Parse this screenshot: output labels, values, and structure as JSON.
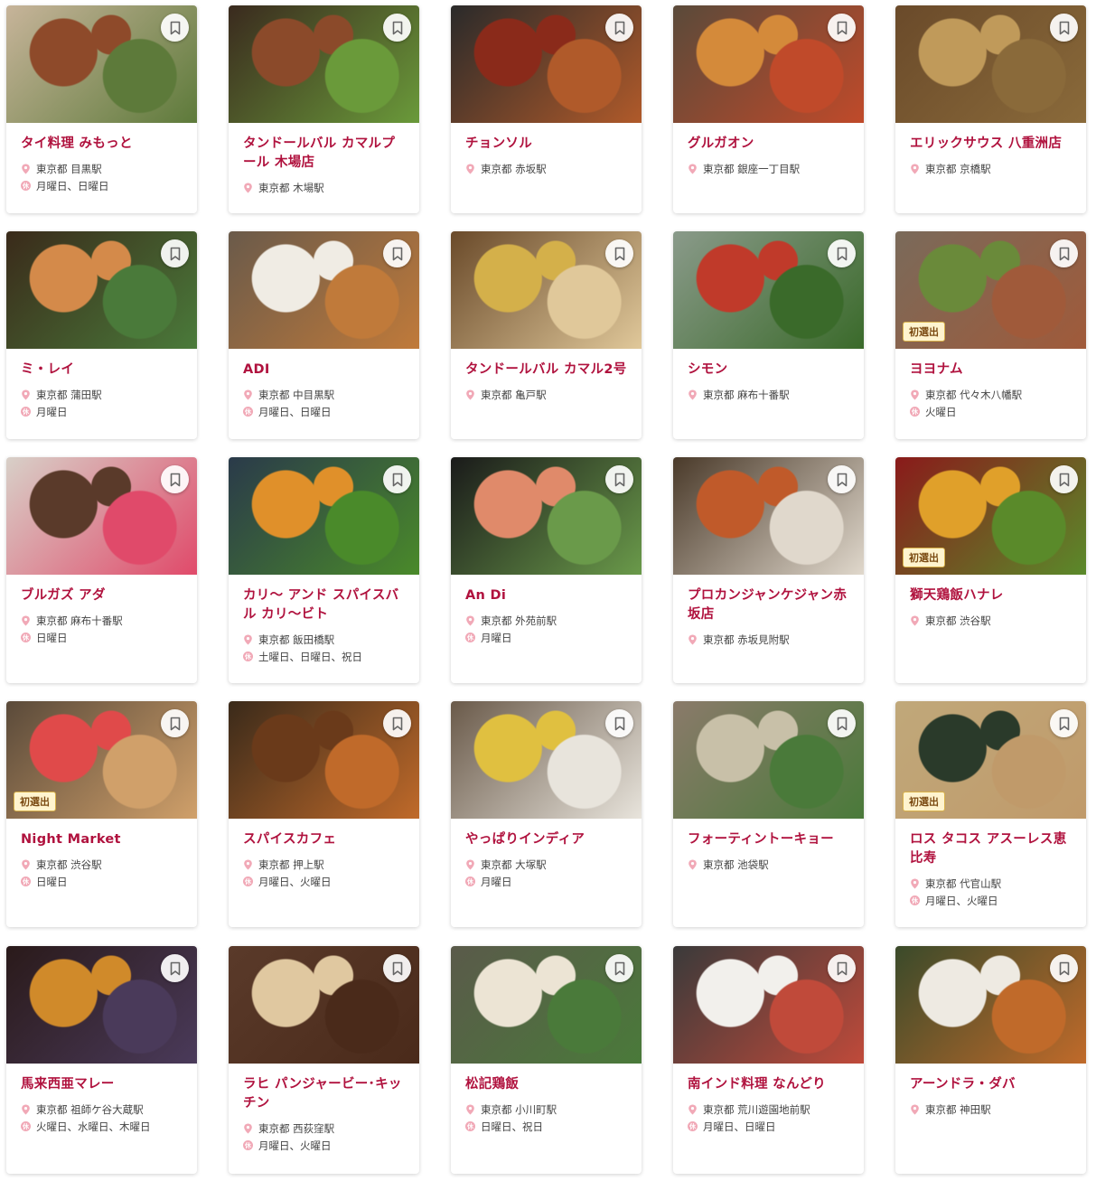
{
  "colors": {
    "accent": "#b0123e",
    "pin": "#f1a9b7",
    "badge_bg": "#fff4cf"
  },
  "closed_icon_glyph": "休",
  "restaurants": [
    {
      "name": "タイ料理 みもっと",
      "location": "東京都 目黒駅",
      "closed": "月曜日、日曜日",
      "badge": "",
      "photo": [
        "#c7b49a",
        "#8e4a2a",
        "#5d7a3a"
      ]
    },
    {
      "name": "タンドールバル カマルプール 木場店",
      "location": "東京都 木場駅",
      "closed": "",
      "badge": "",
      "photo": [
        "#3a2a1e",
        "#8b4a2a",
        "#6a9a3a"
      ]
    },
    {
      "name": "チョンソル",
      "location": "東京都 赤坂駅",
      "closed": "",
      "badge": "",
      "photo": [
        "#2a2a2a",
        "#8a2a1a",
        "#b05a2a"
      ]
    },
    {
      "name": "グルガオン",
      "location": "東京都 銀座一丁目駅",
      "closed": "",
      "badge": "",
      "photo": [
        "#5a4a3a",
        "#d48a3a",
        "#c04a2a"
      ]
    },
    {
      "name": "エリックサウス 八重洲店",
      "location": "東京都 京橋駅",
      "closed": "",
      "badge": "",
      "photo": [
        "#6a4a2a",
        "#c09a5a",
        "#8a6a3a"
      ]
    },
    {
      "name": "ミ・レイ",
      "location": "東京都 蒲田駅",
      "closed": "月曜日",
      "badge": "",
      "photo": [
        "#3a2a1a",
        "#d48a4a",
        "#4a7a3a"
      ]
    },
    {
      "name": "ADI",
      "location": "東京都 中目黒駅",
      "closed": "月曜日、日曜日",
      "badge": "",
      "photo": [
        "#6a5a4a",
        "#f0ece4",
        "#c07a3a"
      ]
    },
    {
      "name": "タンドールバル カマル2号",
      "location": "東京都 亀戸駅",
      "closed": "",
      "badge": "",
      "photo": [
        "#6a4a2a",
        "#d4b04a",
        "#e0c89a"
      ]
    },
    {
      "name": "シモン",
      "location": "東京都 麻布十番駅",
      "closed": "",
      "badge": "",
      "photo": [
        "#8a9a8a",
        "#c03a2a",
        "#3a6a2a"
      ]
    },
    {
      "name": "ヨヨナム",
      "location": "東京都 代々木八幡駅",
      "closed": "火曜日",
      "badge": "初選出",
      "photo": [
        "#7a6a5a",
        "#6a8a3a",
        "#a05a3a"
      ]
    },
    {
      "name": "ブルガズ アダ",
      "location": "東京都 麻布十番駅",
      "closed": "日曜日",
      "badge": "",
      "photo": [
        "#d8d0c8",
        "#5a3a2a",
        "#e04a6a"
      ]
    },
    {
      "name": "カリ〜 アンド スパイスバル カリ〜ビト",
      "location": "東京都 飯田橋駅",
      "closed": "土曜日、日曜日、祝日",
      "badge": "",
      "photo": [
        "#2a3a4a",
        "#e0902a",
        "#4a8a2a"
      ]
    },
    {
      "name": "An Di",
      "location": "東京都 外苑前駅",
      "closed": "月曜日",
      "badge": "",
      "photo": [
        "#1a1a1a",
        "#e08a6a",
        "#6a9a4a"
      ]
    },
    {
      "name": "プロカンジャンケジャン赤坂店",
      "location": "東京都 赤坂見附駅",
      "closed": "",
      "badge": "",
      "photo": [
        "#4a3a2a",
        "#c05a2a",
        "#e0d8cc"
      ]
    },
    {
      "name": "獅天鶏飯ハナレ",
      "location": "東京都 渋谷駅",
      "closed": "",
      "badge": "初選出",
      "photo": [
        "#8a1a1a",
        "#e0a02a",
        "#5a8a2a"
      ]
    },
    {
      "name": "Night Market",
      "location": "東京都 渋谷駅",
      "closed": "日曜日",
      "badge": "初選出",
      "photo": [
        "#5a4a3a",
        "#e04a4a",
        "#d0a06a"
      ]
    },
    {
      "name": "スパイスカフェ",
      "location": "東京都 押上駅",
      "closed": "月曜日、火曜日",
      "badge": "",
      "photo": [
        "#3a2a1a",
        "#6a3a1a",
        "#c06a2a"
      ]
    },
    {
      "name": "やっぱりインディア",
      "location": "東京都 大塚駅",
      "closed": "月曜日",
      "badge": "",
      "photo": [
        "#6a5a4a",
        "#e0c040",
        "#e8e4dc"
      ]
    },
    {
      "name": "フォーティントーキョー",
      "location": "東京都 池袋駅",
      "closed": "",
      "badge": "",
      "photo": [
        "#8a7a6a",
        "#c8c0a8",
        "#4a7a3a"
      ]
    },
    {
      "name": "ロス タコス アスーレス恵比寿",
      "location": "東京都 代官山駅",
      "closed": "月曜日、火曜日",
      "badge": "初選出",
      "photo": [
        "#c0a87a",
        "#2a3a2a",
        "#c09a6a"
      ]
    },
    {
      "name": "馬来西亜マレー",
      "location": "東京都 祖師ケ谷大蔵駅",
      "closed": "火曜日、水曜日、木曜日",
      "badge": "",
      "photo": [
        "#2a1a1a",
        "#d08a2a",
        "#4a3a5a"
      ]
    },
    {
      "name": "ラヒ パンジャービー･キッチン",
      "location": "東京都 西荻窪駅",
      "closed": "月曜日、火曜日",
      "badge": "",
      "photo": [
        "#5a3a2a",
        "#e0c8a0",
        "#4a2a1a"
      ]
    },
    {
      "name": "松記鶏飯",
      "location": "東京都 小川町駅",
      "closed": "日曜日、祝日",
      "badge": "",
      "photo": [
        "#5a5a4a",
        "#ece4d4",
        "#4a7a3a"
      ]
    },
    {
      "name": "南インド料理 なんどり",
      "location": "東京都 荒川遊園地前駅",
      "closed": "月曜日、日曜日",
      "badge": "",
      "photo": [
        "#3a3a3a",
        "#f2f0ec",
        "#c04a3a"
      ]
    },
    {
      "name": "アーンドラ・ダバ",
      "location": "東京都 神田駅",
      "closed": "",
      "badge": "",
      "photo": [
        "#3a4a2a",
        "#eeeae2",
        "#c06a2a"
      ]
    }
  ]
}
